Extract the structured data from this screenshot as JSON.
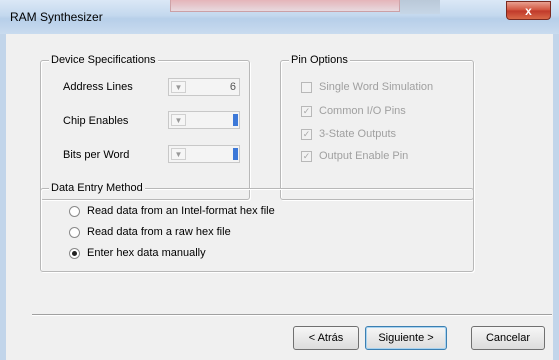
{
  "window": {
    "title": "RAM Synthesizer",
    "close_glyph": "x"
  },
  "device_specs": {
    "title": "Device Specifications",
    "address_lines": {
      "label": "Address Lines",
      "value": "6"
    },
    "chip_enables": {
      "label": "Chip Enables",
      "value": ""
    },
    "bits_per_word": {
      "label": "Bits per Word",
      "value": ""
    }
  },
  "pin_options": {
    "title": "Pin Options",
    "items": [
      {
        "label": "Single Word Simulation",
        "checked": false
      },
      {
        "label": "Common I/O Pins",
        "checked": true
      },
      {
        "label": "3-State Outputs",
        "checked": true
      },
      {
        "label": "Output Enable Pin",
        "checked": true
      }
    ]
  },
  "data_entry": {
    "title": "Data Entry Method",
    "options": [
      {
        "label": "Read data from an Intel-format hex file",
        "selected": false
      },
      {
        "label": "Read data from a raw hex file",
        "selected": false
      },
      {
        "label": "Enter hex data manually",
        "selected": true
      }
    ]
  },
  "buttons": {
    "back": "< Atrás",
    "next": "Siguiente >",
    "cancel": "Cancelar"
  },
  "colors": {
    "selection": "#3c78d8",
    "close_button": "#c0382a",
    "disabled_text": "#a0a0a0"
  }
}
